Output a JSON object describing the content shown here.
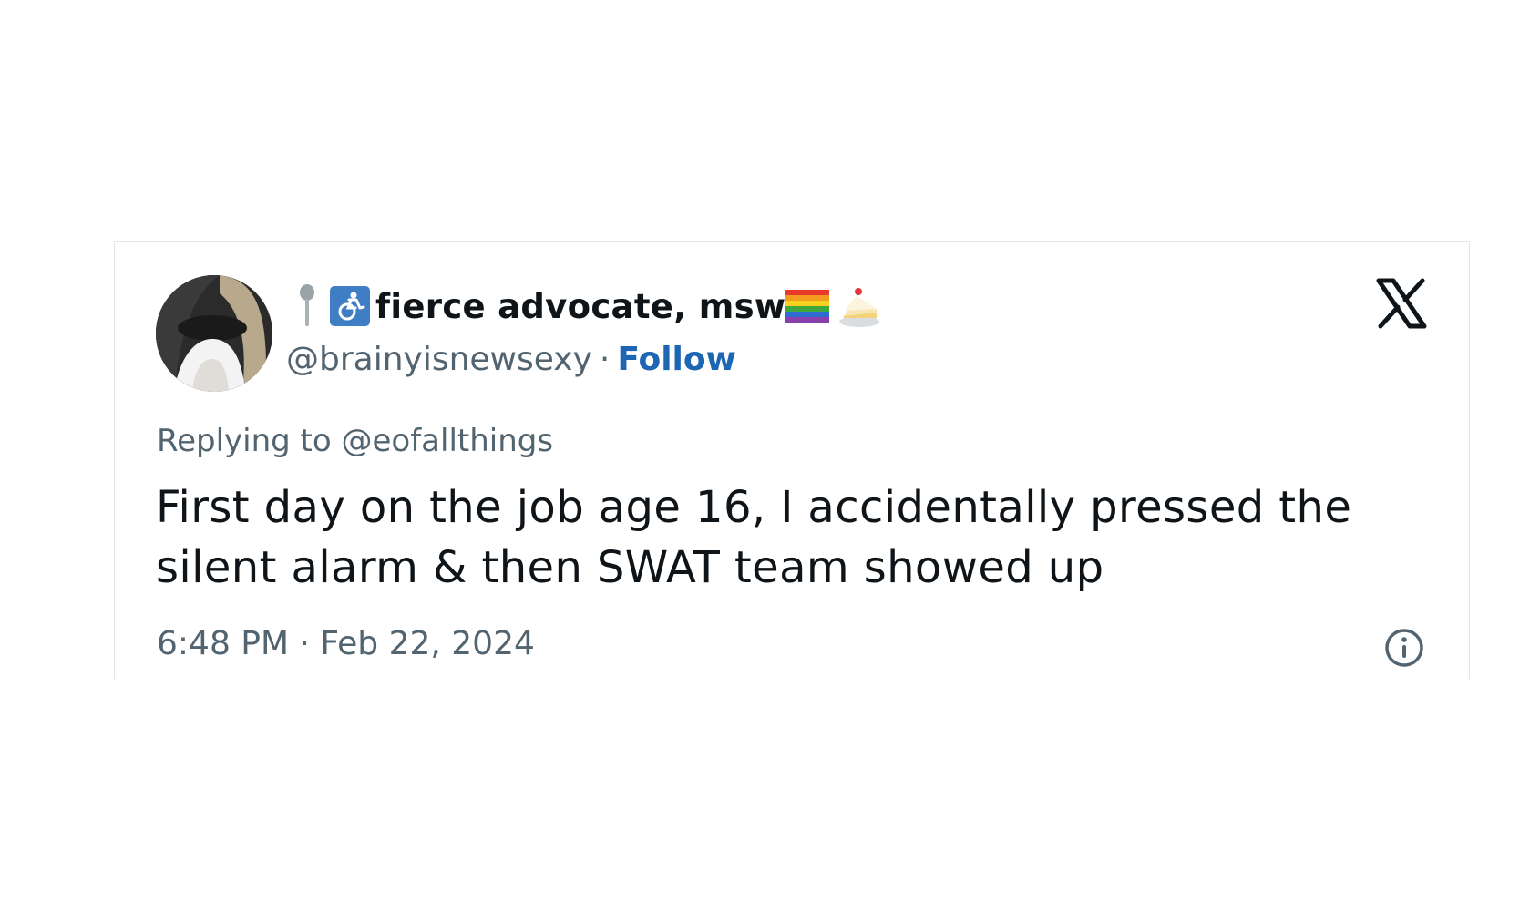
{
  "tweet": {
    "display_name": "fierce advocate, msw",
    "handle": "@brainyisnewsexy",
    "separator": "·",
    "follow_label": "Follow",
    "replying_to": "Replying to @eofallthings",
    "text": "First day on the job age 16, I accidentally pressed the silent alarm & then SWAT team showed up",
    "timestamp": "6:48 PM · Feb 22, 2024"
  },
  "icons": {
    "avatar": "user-avatar",
    "pin": "pushpin-emoji-icon",
    "accessibility": "wheelchair-emoji-icon",
    "flag": "rainbow-flag-emoji-icon",
    "cake": "cake-emoji-icon",
    "logo": "x-logo-icon",
    "info": "info-icon"
  },
  "colors": {
    "text": "#0f1419",
    "muted": "#536471",
    "follow": "#1d66b3",
    "border": "#e3e6e8",
    "wheelchair_bg": "#3f7dc4"
  }
}
